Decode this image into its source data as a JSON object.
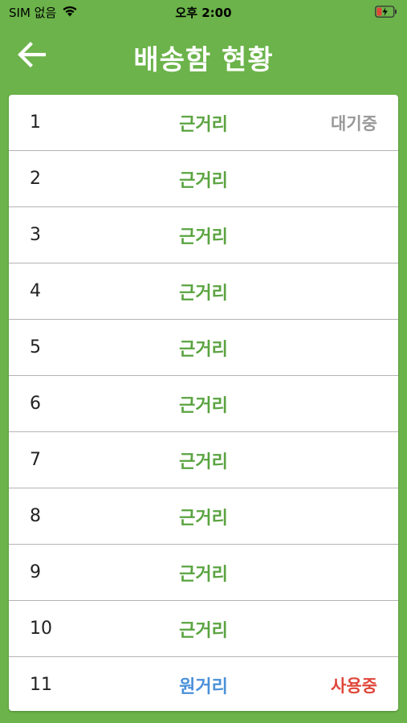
{
  "status_bar": {
    "carrier": "SIM 없음",
    "time": "오후 2:00",
    "wifi_icon": "wifi-icon",
    "battery_icon": "battery-charging-icon"
  },
  "header": {
    "back_icon": "arrow-left-icon",
    "title": "배송함 현황"
  },
  "colors": {
    "background": "#6bb34a",
    "near": "#5aa340",
    "far": "#4a90d9",
    "waiting": "#999999",
    "in_use": "#e0463a"
  },
  "rows": [
    {
      "number": "1",
      "type": "근거리",
      "type_kind": "near",
      "status": "대기중",
      "status_kind": "waiting"
    },
    {
      "number": "2",
      "type": "근거리",
      "type_kind": "near",
      "status": "",
      "status_kind": ""
    },
    {
      "number": "3",
      "type": "근거리",
      "type_kind": "near",
      "status": "",
      "status_kind": ""
    },
    {
      "number": "4",
      "type": "근거리",
      "type_kind": "near",
      "status": "",
      "status_kind": ""
    },
    {
      "number": "5",
      "type": "근거리",
      "type_kind": "near",
      "status": "",
      "status_kind": ""
    },
    {
      "number": "6",
      "type": "근거리",
      "type_kind": "near",
      "status": "",
      "status_kind": ""
    },
    {
      "number": "7",
      "type": "근거리",
      "type_kind": "near",
      "status": "",
      "status_kind": ""
    },
    {
      "number": "8",
      "type": "근거리",
      "type_kind": "near",
      "status": "",
      "status_kind": ""
    },
    {
      "number": "9",
      "type": "근거리",
      "type_kind": "near",
      "status": "",
      "status_kind": ""
    },
    {
      "number": "10",
      "type": "근거리",
      "type_kind": "near",
      "status": "",
      "status_kind": ""
    },
    {
      "number": "11",
      "type": "원거리",
      "type_kind": "far",
      "status": "사용중",
      "status_kind": "in_use"
    }
  ]
}
